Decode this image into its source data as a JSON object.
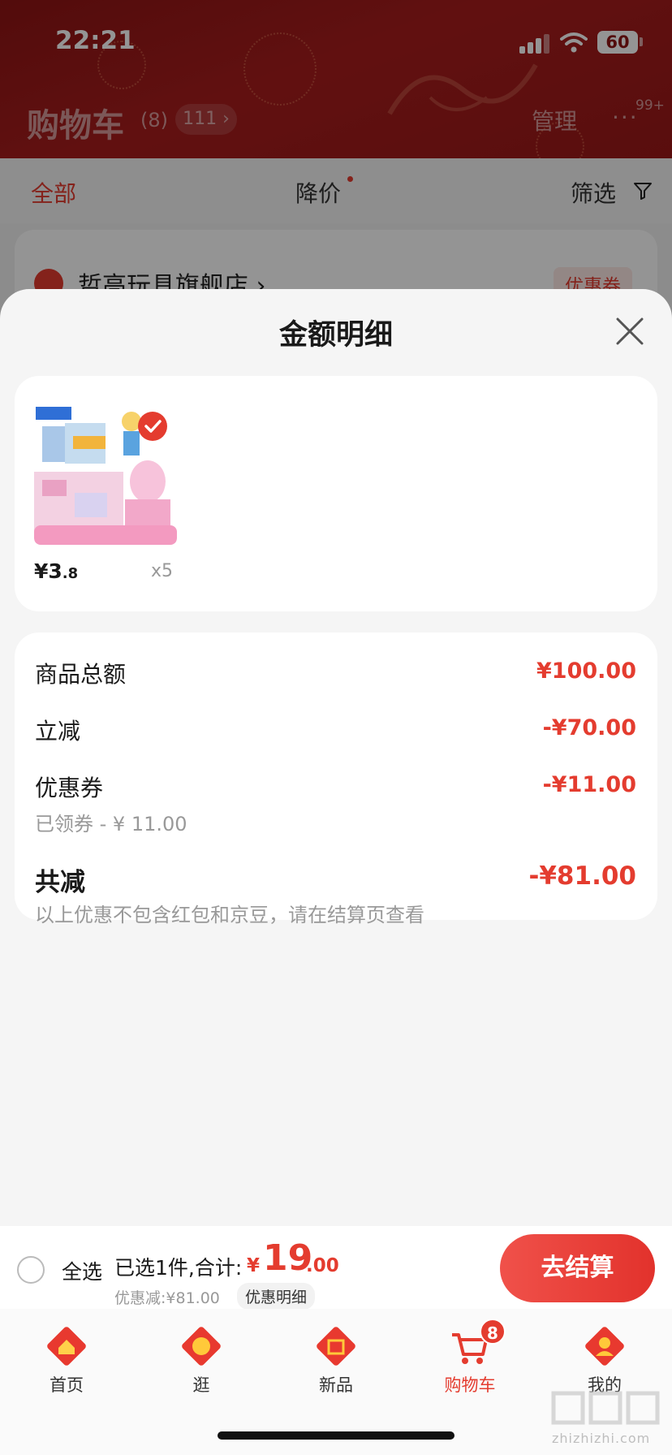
{
  "status_bar": {
    "time": "22:21",
    "battery": "60"
  },
  "cart_header": {
    "title": "购物车",
    "count": "(8)",
    "pill": "111 ›",
    "manage": "管理",
    "more": "···",
    "more_badge": "99+"
  },
  "filter_bar": {
    "all": "全部",
    "price_drop": "降价",
    "filter": "筛选"
  },
  "store": {
    "name": "哲高玩具旗舰店 ›",
    "coupon": "优惠券"
  },
  "sheet": {
    "title": "金额明细",
    "item": {
      "price_int": "¥3",
      "price_dec": ".8",
      "quantity": "x5"
    },
    "summary": {
      "goods_total_label": "商品总额",
      "goods_total_value": "¥100.00",
      "instant_off_label": "立减",
      "instant_off_value": "-¥70.00",
      "coupon_label": "优惠券",
      "coupon_value": "-¥11.00",
      "coupon_sub": "已领券 - ¥ 11.00",
      "total_off_label": "共减",
      "total_off_value": "-¥81.00",
      "note": "以上优惠不包含红包和京豆，请在结算页查看"
    }
  },
  "checkout": {
    "select_all": "全选",
    "selected_text": "已选1件,合计:",
    "total_yen": "¥",
    "total_int": "19",
    "total_dec": ".00",
    "discount_line": "优惠减:¥81.00",
    "detail_pill": "优惠明细",
    "button": "去结算"
  },
  "tabs": [
    {
      "label": "首页",
      "icon": "home-icon"
    },
    {
      "label": "逛",
      "icon": "browse-icon"
    },
    {
      "label": "新品",
      "icon": "new-products-icon"
    },
    {
      "label": "购物车",
      "icon": "cart-icon",
      "badge": "8"
    },
    {
      "label": "我的",
      "icon": "profile-icon"
    }
  ],
  "watermark": "zhizhizhi.com",
  "colors": {
    "accent": "#e43c2f",
    "header": "#9a1818"
  }
}
